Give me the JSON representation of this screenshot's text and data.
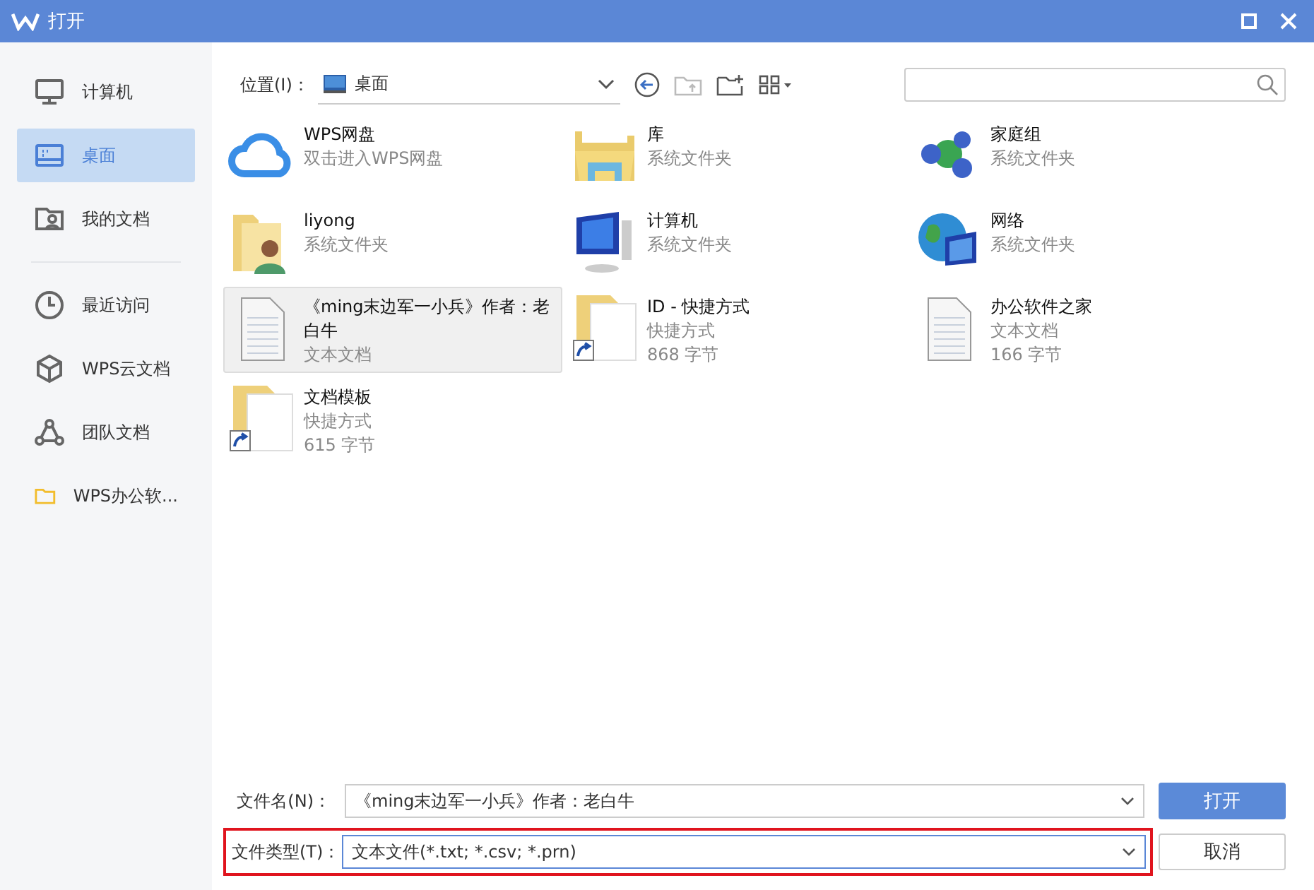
{
  "window": {
    "title": "打开"
  },
  "sidebar": {
    "items": [
      {
        "label": "计算机",
        "kind": "computer",
        "selected": false
      },
      {
        "label": "桌面",
        "kind": "desktop",
        "selected": true
      },
      {
        "label": "我的文档",
        "kind": "documents",
        "selected": false
      },
      {
        "label": "最近访问",
        "kind": "recent",
        "selected": false
      },
      {
        "label": "WPS云文档",
        "kind": "cloud-docs",
        "selected": false
      },
      {
        "label": "团队文档",
        "kind": "team",
        "selected": false
      },
      {
        "label": "WPS办公软...",
        "kind": "folder",
        "selected": false
      }
    ]
  },
  "location": {
    "label": "位置(I)：",
    "value": "桌面"
  },
  "files": [
    {
      "name": "WPS网盘",
      "kind": "cloud",
      "details": [
        "双击进入WPS网盘"
      ],
      "selected": false
    },
    {
      "name": "库",
      "kind": "library",
      "details": [
        "系统文件夹"
      ],
      "selected": false
    },
    {
      "name": "家庭组",
      "kind": "homegroup",
      "details": [
        "系统文件夹"
      ],
      "selected": false
    },
    {
      "name": "liyong",
      "kind": "user-folder",
      "details": [
        "系统文件夹"
      ],
      "selected": false
    },
    {
      "name": "计算机",
      "kind": "computer",
      "details": [
        "系统文件夹"
      ],
      "selected": false
    },
    {
      "name": "网络",
      "kind": "network",
      "details": [
        "系统文件夹"
      ],
      "selected": false
    },
    {
      "name": "《ming末边军一小兵》作者：老白牛",
      "kind": "text",
      "details": [
        "文本文档"
      ],
      "selected": true
    },
    {
      "name": "ID - 快捷方式",
      "kind": "shortcut",
      "details": [
        "快捷方式",
        "868 字节"
      ],
      "selected": false
    },
    {
      "name": "办公软件之家",
      "kind": "text",
      "details": [
        "文本文档",
        "166 字节"
      ],
      "selected": false
    },
    {
      "name": "文档模板",
      "kind": "shortcut",
      "details": [
        "快捷方式",
        "615 字节"
      ],
      "selected": false
    }
  ],
  "filename": {
    "label": "文件名(N)：",
    "value": "《ming末边军一小兵》作者：老白牛"
  },
  "filetype": {
    "label": "文件类型(T)：",
    "value": "文本文件(*.txt; *.csv; *.prn)",
    "highlighted": true
  },
  "buttons": [
    "打开",
    "取消"
  ]
}
